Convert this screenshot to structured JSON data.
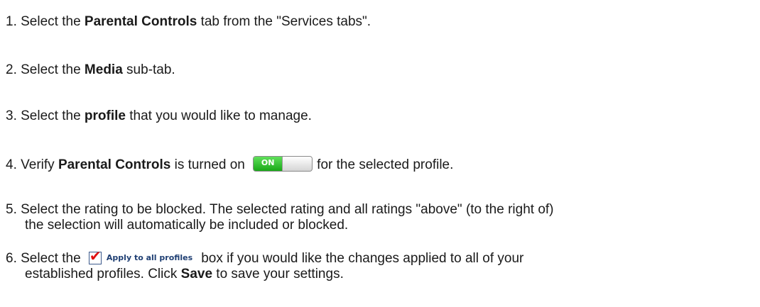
{
  "steps": [
    {
      "number": "1.",
      "pre": " Select the ",
      "bold": "Parental Controls",
      "post": " tab from the \"Services tabs\"."
    },
    {
      "number": "2.",
      "pre": " Select the ",
      "bold": "Media",
      "post": " sub-tab."
    },
    {
      "number": "3.",
      "pre": " Select the ",
      "bold": "profile",
      "post": " that you would like to manage."
    },
    {
      "number": "4.",
      "pre": " Verify ",
      "bold": "Parental Controls",
      "mid": " is turned on",
      "post": "for the selected profile."
    },
    {
      "number": "5.",
      "line1": " Select the rating to be blocked. The selected rating and all ratings \"above\" (to the right of)",
      "line2": "the selection will automatically be included or blocked."
    },
    {
      "number": "6.",
      "pre": " Select the",
      "post": "box if you would like the changes applied to all of your",
      "line2_pre": "established profiles. Click ",
      "line2_bold": "Save",
      "line2_post": " to save your settings."
    }
  ],
  "toggle": {
    "label": "ON",
    "state": "on",
    "color": "#19a818"
  },
  "apply_checkbox": {
    "label": "Apply to all profiles",
    "checked": true,
    "check_color": "#e01010"
  }
}
